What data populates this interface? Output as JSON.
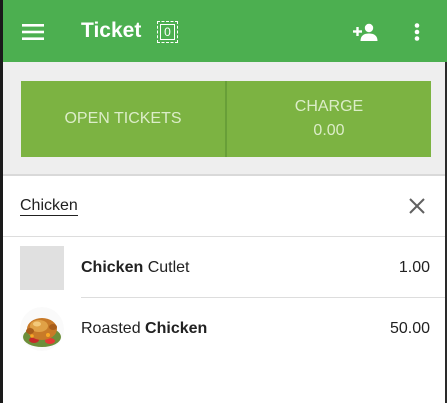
{
  "app_bar": {
    "title": "Ticket",
    "ticket_count": "0",
    "menu_icon": "hamburger-menu-icon",
    "add_customer_icon": "add-person-icon",
    "more_icon": "more-vert-icon",
    "color": "#4caf50"
  },
  "actions": {
    "open_tickets_label": "OPEN TICKETS",
    "charge_label": "CHARGE",
    "charge_amount": "0.00",
    "button_color": "#7cb342"
  },
  "search": {
    "query": "Chicken",
    "clear_icon": "close-icon"
  },
  "items": [
    {
      "name_bold": "Chicken",
      "name_rest": " Cutlet",
      "price": "1.00",
      "thumbnail": "grey-placeholder"
    },
    {
      "name_pre": "Roasted ",
      "name_bold": "Chicken",
      "price": "50.00",
      "thumbnail": "roasted-chicken-image"
    }
  ]
}
